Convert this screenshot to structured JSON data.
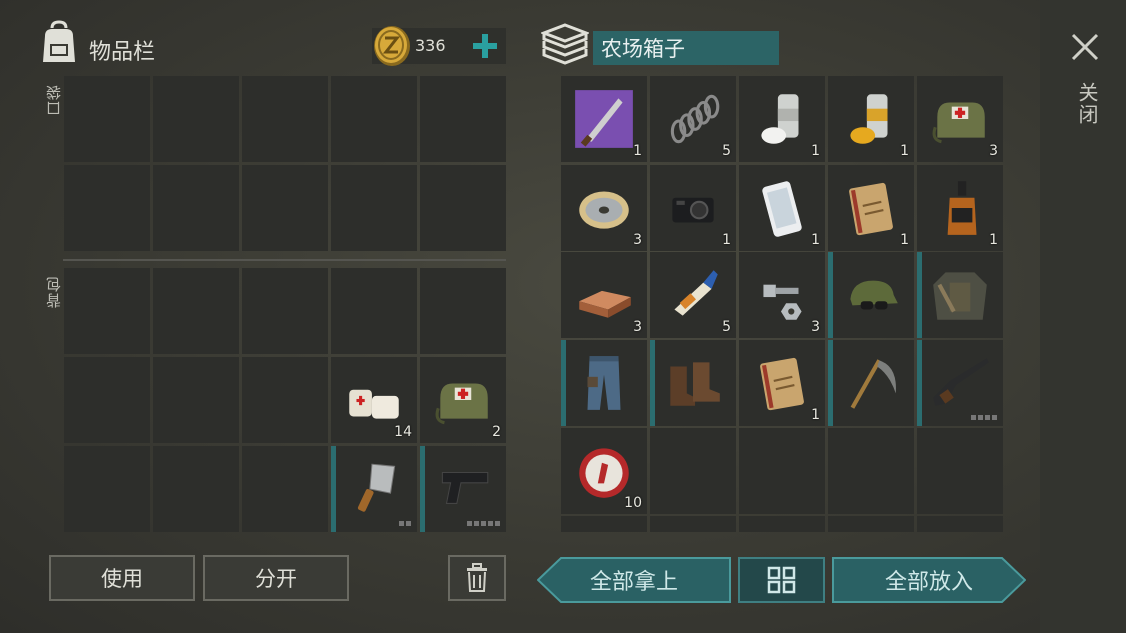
{
  "colors": {
    "accent_teal": "#2c6466",
    "slot_bg": "#2d2e2b",
    "durability_bar": "#2b6d70"
  },
  "inventory": {
    "title": "物品栏",
    "coin_amount": "336",
    "pocket_label": "口袋",
    "backpack_label": "背包",
    "backpack_items": [
      {
        "slot": "r2c4",
        "icon": "bandage-icon",
        "count": "14"
      },
      {
        "slot": "r2c5",
        "icon": "medkit-bag-icon",
        "count": "2"
      },
      {
        "slot": "r3c4",
        "icon": "cleaver-icon",
        "count": "",
        "durability_dots": 2
      },
      {
        "slot": "r3c5",
        "icon": "pistol-icon",
        "count": "",
        "durability_dots": 5
      }
    ],
    "buttons": {
      "use": "使用",
      "split": "分开",
      "trash_icon": "trash-icon"
    }
  },
  "chest": {
    "title": "农场箱子",
    "items": [
      {
        "icon": "machete-blueprint-icon",
        "count": "1"
      },
      {
        "icon": "spring-icon",
        "count": "5"
      },
      {
        "icon": "white-paint-can-icon",
        "count": "1"
      },
      {
        "icon": "yellow-paint-can-icon",
        "count": "1"
      },
      {
        "icon": "medkit-bag-icon",
        "count": "3"
      },
      {
        "icon": "wire-spool-icon",
        "count": "3"
      },
      {
        "icon": "camera-icon",
        "count": "1"
      },
      {
        "icon": "smartphone-icon",
        "count": "1"
      },
      {
        "icon": "diary-icon",
        "count": "1"
      },
      {
        "icon": "whiskey-bottle-icon",
        "count": "1"
      },
      {
        "icon": "copper-ingot-icon",
        "count": "3"
      },
      {
        "icon": "glue-tube-icon",
        "count": "5"
      },
      {
        "icon": "bolt-nut-icon",
        "count": "3"
      },
      {
        "icon": "camo-cap-sunglasses-icon",
        "count": ""
      },
      {
        "icon": "tactical-jacket-icon",
        "count": ""
      },
      {
        "icon": "jeans-icon",
        "count": ""
      },
      {
        "icon": "boots-icon",
        "count": ""
      },
      {
        "icon": "diary-icon",
        "count": "1"
      },
      {
        "icon": "scythe-icon",
        "count": ""
      },
      {
        "icon": "shotgun-icon",
        "count": "",
        "durability_dots": 4
      },
      {
        "icon": "bottle-cap-icon",
        "count": "10"
      }
    ],
    "buttons": {
      "take_all": "全部拿上",
      "put_all": "全部放入",
      "grid_icon": "grid-view-icon"
    }
  },
  "close": {
    "label": "关闭",
    "icon": "close-icon"
  }
}
